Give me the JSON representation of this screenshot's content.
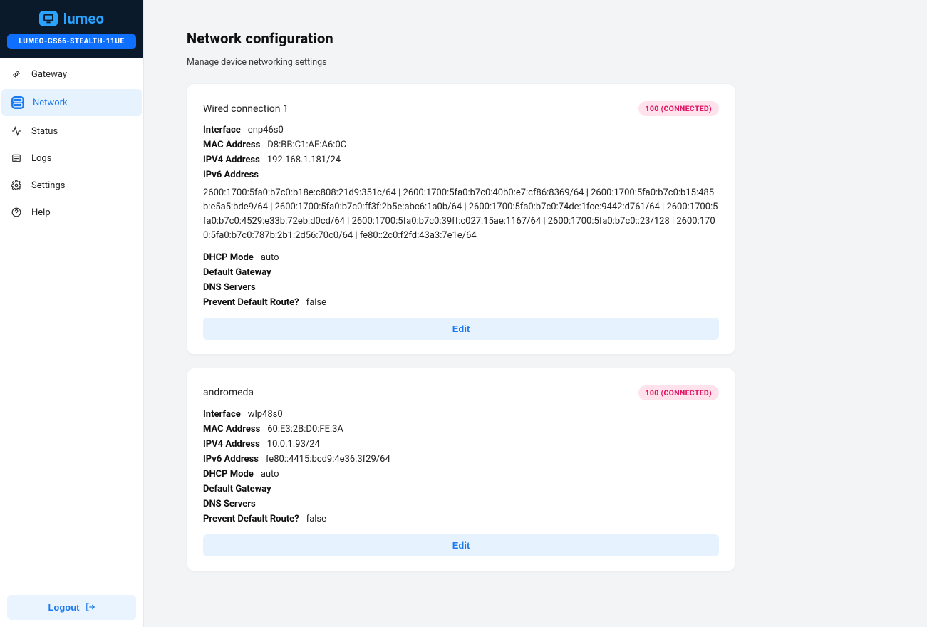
{
  "brand": {
    "name": "lumeo"
  },
  "device_label": "LUMEO-GS66-STEALTH-11UE",
  "nav": [
    {
      "key": "gateway",
      "label": "Gateway"
    },
    {
      "key": "network",
      "label": "Network"
    },
    {
      "key": "status",
      "label": "Status"
    },
    {
      "key": "logs",
      "label": "Logs"
    },
    {
      "key": "settings",
      "label": "Settings"
    },
    {
      "key": "help",
      "label": "Help"
    }
  ],
  "active_nav": "network",
  "logout_label": "Logout",
  "page": {
    "title": "Network configuration",
    "subtitle": "Manage device networking settings"
  },
  "labels": {
    "interface": "Interface",
    "mac": "MAC Address",
    "ipv4": "IPV4 Address",
    "ipv6": "IPv6 Address",
    "dhcp": "DHCP Mode",
    "gateway": "Default Gateway",
    "dns": "DNS Servers",
    "prevent_default_route": "Prevent Default Route?",
    "edit": "Edit"
  },
  "connections": [
    {
      "name": "Wired connection 1",
      "status": "100 (CONNECTED)",
      "interface": "enp46s0",
      "mac": "D8:BB:C1:AE:A6:0C",
      "ipv4": "192.168.1.181/24",
      "ipv6": "2600:1700:5fa0:b7c0:b18e:c808:21d9:351c/64 | 2600:1700:5fa0:b7c0:40b0:e7:cf86:8369/64 | 2600:1700:5fa0:b7c0:b15:485b:e5a5:bde9/64 | 2600:1700:5fa0:b7c0:ff3f:2b5e:abc6:1a0b/64 | 2600:1700:5fa0:b7c0:74de:1fce:9442:d761/64 | 2600:1700:5fa0:b7c0:4529:e33b:72eb:d0cd/64 | 2600:1700:5fa0:b7c0:39ff:c027:15ae:1167/64 | 2600:1700:5fa0:b7c0::23/128 | 2600:1700:5fa0:b7c0:787b:2b1:2d56:70c0/64 | fe80::2c0:f2fd:43a3:7e1e/64",
      "ipv6_multiline": true,
      "dhcp_mode": "auto",
      "default_gateway": "",
      "dns_servers": "",
      "prevent_default_route": "false"
    },
    {
      "name": "andromeda",
      "status": "100 (CONNECTED)",
      "interface": "wlp48s0",
      "mac": "60:E3:2B:D0:FE:3A",
      "ipv4": "10.0.1.93/24",
      "ipv6": "fe80::4415:bcd9:4e36:3f29/64",
      "ipv6_multiline": false,
      "dhcp_mode": "auto",
      "default_gateway": "",
      "dns_servers": "",
      "prevent_default_route": "false"
    }
  ]
}
